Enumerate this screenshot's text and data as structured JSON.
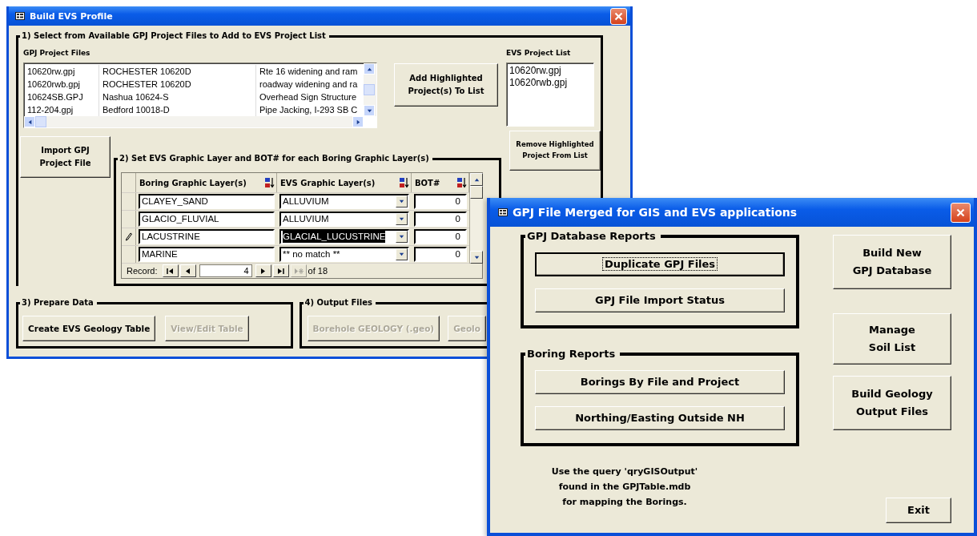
{
  "back_window": {
    "title": "Build EVS Profile",
    "section1": {
      "legend": "1) Select from Available GPJ Project Files to Add to EVS Project List",
      "list_label": "GPJ Project Files",
      "files": [
        {
          "file": "10620rw.gpj",
          "project": "ROCHESTER 10620D",
          "description": "Rte 16 widening and ram"
        },
        {
          "file": "10620rwb.gpj",
          "project": "ROCHESTER 10620D",
          "description": "roadway widening and ra"
        },
        {
          "file": "10624SB.GPJ",
          "project": "Nashua 10624-S",
          "description": "Overhead Sign Structure"
        },
        {
          "file": "112-204.gpj",
          "project": "Bedford 10018-D",
          "description": "Pipe Jacking, I-293 SB C"
        }
      ],
      "add_button": "Add Highlighted\nProject(s) To List",
      "evs_list_label": "EVS Project List",
      "evs_list": [
        "10620rw.gpj",
        "10620rwb.gpj"
      ],
      "remove_button": "Remove Highlighted\nProject From List"
    },
    "import_button": "Import GPJ\nProject File",
    "section2": {
      "legend": "2) Set EVS Graphic Layer and BOT# for each Boring Graphic Layer(s)",
      "columns": [
        "Boring Graphic Layer(s)",
        "EVS Graphic Layer(s)",
        "BOT#"
      ],
      "rows": [
        {
          "boring_layer": "CLAYEY_SAND",
          "evs_layer": "ALLUVIUM",
          "bot": "0",
          "editing": false
        },
        {
          "boring_layer": "GLACIO_FLUVIAL",
          "evs_layer": "ALLUVIUM",
          "bot": "0",
          "editing": false
        },
        {
          "boring_layer": "LACUSTRINE",
          "evs_layer": "GLACIAL_LUCUSTRINE",
          "bot": "0",
          "editing": true
        },
        {
          "boring_layer": "MARINE",
          "evs_layer": "** no match **",
          "bot": "0",
          "editing": false
        }
      ],
      "record_label": "Record:",
      "record": "4",
      "record_total": "of 18",
      "new_record_disabled": true
    },
    "section3": {
      "legend": "3) Prepare Data",
      "buttons": [
        {
          "label": "Create EVS Geology Table",
          "disabled": false
        },
        {
          "label": "View/Edit Table",
          "disabled": true
        }
      ]
    },
    "section4": {
      "legend": "4) Output Files",
      "buttons": [
        {
          "label": "Borehole GEOLOGY (.geo)",
          "disabled": true
        },
        {
          "label": "Geolo",
          "disabled": true
        }
      ]
    }
  },
  "front_window": {
    "title": "GPJ File Merged for GIS and EVS applications",
    "groups": [
      {
        "legend": "GPJ Database Reports",
        "buttons": [
          {
            "label": "Duplicate GPJ Files",
            "focused": true
          },
          {
            "label": "GPJ File Import Status",
            "focused": false
          }
        ]
      },
      {
        "legend": "Boring Reports",
        "buttons": [
          {
            "label": "Borings By File and Project",
            "focused": false
          },
          {
            "label": "Northing/Easting Outside NH",
            "focused": false
          }
        ]
      }
    ],
    "note": "Use the query 'qryGISOutput'\nfound in the GPJTable.mdb\nfor mapping the Borings.",
    "side_buttons": [
      "Build New\nGPJ Database",
      "Manage\nSoil List",
      "Build Geology\nOutput Files"
    ],
    "exit_button": "Exit"
  }
}
